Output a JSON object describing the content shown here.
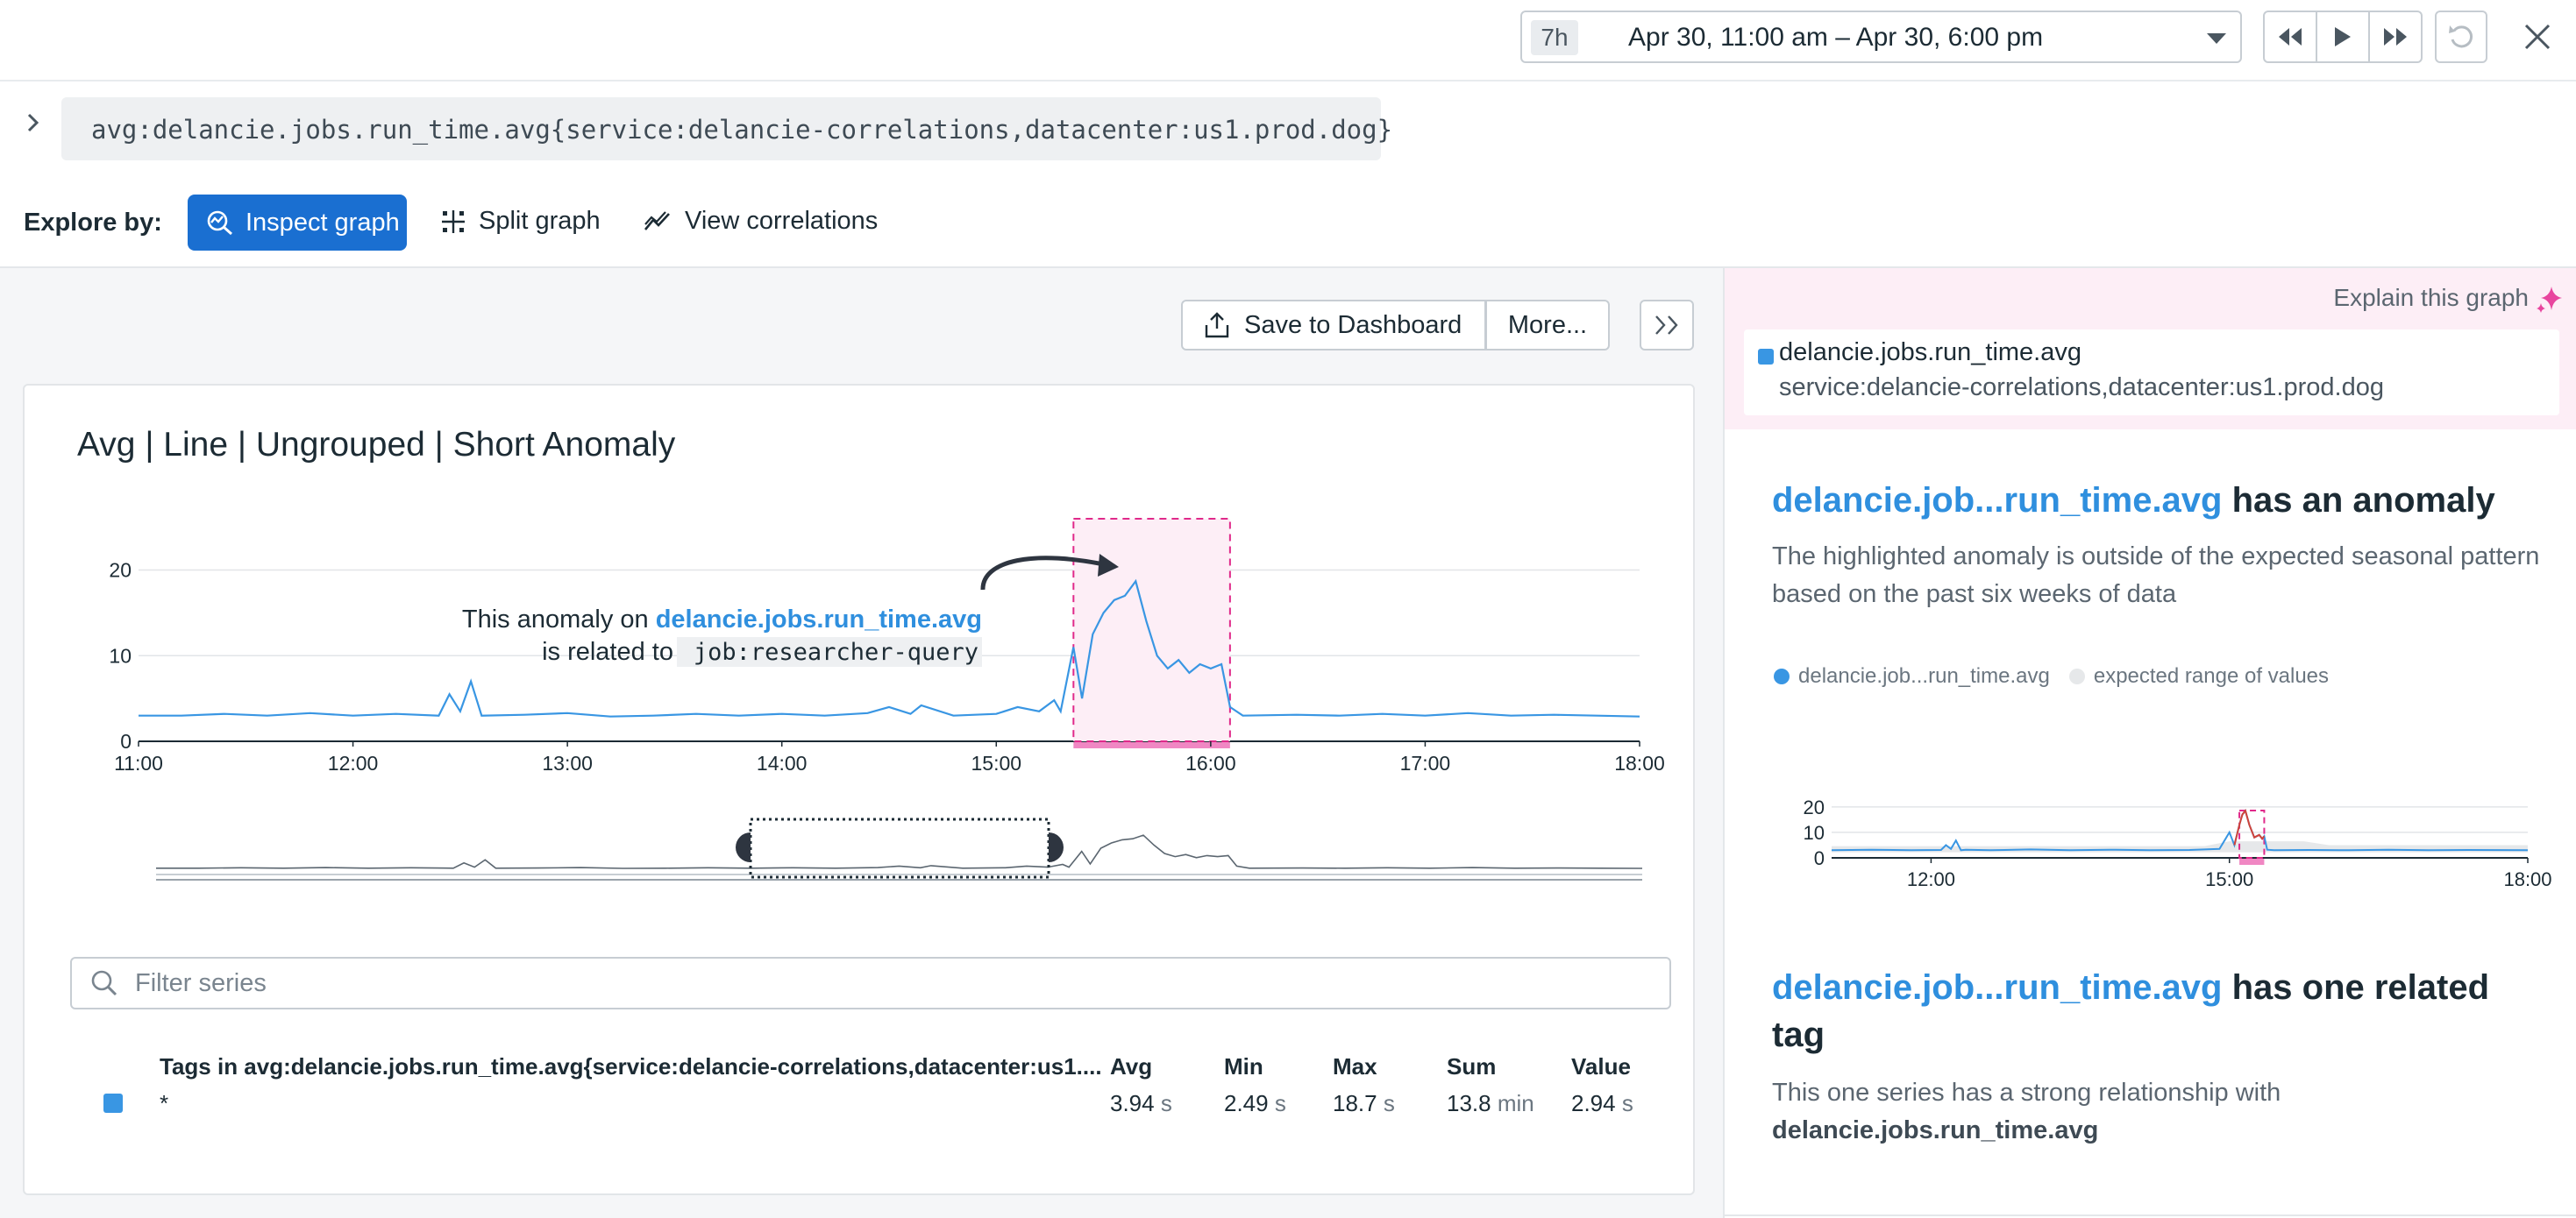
{
  "topbar": {
    "time_badge": "7h",
    "time_range": "Apr 30, 11:00 am – Apr 30, 6:00 pm"
  },
  "query": {
    "text": "avg:delancie.jobs.run_time.avg{service:delancie-correlations,datacenter:us1.prod.dog}"
  },
  "explore": {
    "label": "Explore by:",
    "inspect": "Inspect graph",
    "split": "Split graph",
    "correlations": "View correlations"
  },
  "actions": {
    "save": "Save to Dashboard",
    "more": "More..."
  },
  "card": {
    "title": "Avg | Line | Ungrouped | Short Anomaly",
    "annotation_prefix": "This anomaly on ",
    "annotation_metric": "delancie.jobs.run_time.avg",
    "annotation_related": "is related to ",
    "annotation_tag": "job:researcher-query",
    "filter_placeholder": "Filter series"
  },
  "table": {
    "headers": {
      "tags": "Tags in avg:delancie.jobs.run_time.avg{service:delancie-correlations,datacenter:us1....",
      "avg": "Avg",
      "min": "Min",
      "max": "Max",
      "sum": "Sum",
      "value": "Value"
    },
    "row": {
      "tag": "*",
      "avg": "3.94",
      "avg_unit": "s",
      "min": "2.49",
      "min_unit": "s",
      "max": "18.7",
      "max_unit": "s",
      "sum": "13.8",
      "sum_unit": "min",
      "value": "2.94",
      "value_unit": "s"
    },
    "series_color": "#3996e3"
  },
  "sidebar": {
    "explain": "Explain this graph",
    "series_name": "delancie.jobs.run_time.avg",
    "series_tags": "service:delancie-correlations,datacenter:us1.prod.dog",
    "anomaly_link": "delancie.job...run_time.avg",
    "anomaly_suffix": " has an anomaly",
    "anomaly_desc": "The highlighted anomaly is outside of the expected seasonal pattern based on the past six weeks of data",
    "legend_series": "delancie.job...run_time.avg",
    "legend_expected": "expected range of values",
    "related_link": "delancie.job...run_time.avg",
    "related_suffix": " has one related tag",
    "related_desc": "This one series has a strong relationship with",
    "related_metric": "delancie.jobs.run_time.avg"
  },
  "chart_data": [
    {
      "type": "line",
      "title": "Avg | Line | Ungrouped | Short Anomaly",
      "x_ticks": [
        "11:00",
        "12:00",
        "13:00",
        "14:00",
        "15:00",
        "16:00",
        "17:00",
        "18:00"
      ],
      "y_ticks": [
        0,
        10,
        20
      ],
      "ylim": [
        0,
        22
      ],
      "x_range_hours": [
        11,
        18
      ],
      "anomaly_window": [
        15.36,
        16.09
      ],
      "series": [
        {
          "color": "#3996e3",
          "x": [
            11.0,
            11.2,
            11.4,
            11.6,
            11.8,
            12.0,
            12.2,
            12.4,
            12.45,
            12.5,
            12.55,
            12.6,
            12.8,
            13.0,
            13.2,
            13.4,
            13.6,
            13.8,
            14.0,
            14.2,
            14.4,
            14.5,
            14.6,
            14.65,
            14.8,
            15.0,
            15.1,
            15.2,
            15.27,
            15.3,
            15.36,
            15.4,
            15.45,
            15.5,
            15.55,
            15.6,
            15.65,
            15.7,
            15.75,
            15.8,
            15.85,
            15.9,
            15.95,
            16.0,
            16.05,
            16.09,
            16.15,
            16.4,
            16.6,
            16.8,
            17.0,
            17.2,
            17.4,
            17.6,
            17.8,
            18.0
          ],
          "y": [
            3.0,
            3.0,
            3.2,
            3.0,
            3.3,
            3.0,
            3.2,
            3.0,
            5.5,
            3.5,
            7.0,
            3.0,
            3.1,
            3.3,
            2.9,
            3.0,
            3.2,
            3.0,
            3.2,
            3.0,
            3.3,
            4.0,
            3.2,
            4.2,
            3.0,
            3.2,
            4.0,
            3.5,
            4.8,
            3.5,
            11.0,
            5.0,
            12.5,
            15.0,
            16.5,
            17.0,
            18.7,
            14.0,
            10.0,
            8.5,
            9.5,
            8.0,
            9.0,
            8.5,
            9.0,
            4.0,
            3.0,
            3.1,
            3.0,
            3.2,
            3.0,
            3.3,
            3.0,
            3.1,
            3.0,
            2.9
          ]
        }
      ]
    },
    {
      "type": "line",
      "x_ticks": [
        "12:00",
        "15:00",
        "18:00"
      ],
      "y_ticks": [
        0,
        10,
        20
      ],
      "ylim": [
        0,
        22
      ],
      "x_range_hours": [
        11,
        18
      ],
      "anomaly_window": [
        15.1,
        15.35
      ],
      "series": [
        {
          "name": "delancie.job...run_time.avg",
          "color": "#3996e3",
          "anomaly_color": "#d0433a",
          "x": [
            11.0,
            11.4,
            11.8,
            12.1,
            12.15,
            12.2,
            12.25,
            12.3,
            12.35,
            12.6,
            13.0,
            13.4,
            13.8,
            14.2,
            14.6,
            14.9,
            15.0,
            15.05,
            15.1,
            15.13,
            15.16,
            15.2,
            15.25,
            15.3,
            15.33,
            15.35,
            15.38,
            15.45,
            15.8,
            16.2,
            16.6,
            17.0,
            17.4,
            18.0
          ],
          "y": [
            3.0,
            3.2,
            3.0,
            3.1,
            5.0,
            3.5,
            6.8,
            3.0,
            3.2,
            3.0,
            3.3,
            3.0,
            3.2,
            3.0,
            3.1,
            3.5,
            10.0,
            5.0,
            13.0,
            17.0,
            18.5,
            13.0,
            8.0,
            9.0,
            7.5,
            8.5,
            3.2,
            3.0,
            3.1,
            3.0,
            3.2,
            3.0,
            3.1,
            3.0
          ]
        },
        {
          "name": "expected range of values",
          "color": "#e6e8ea"
        }
      ]
    }
  ]
}
